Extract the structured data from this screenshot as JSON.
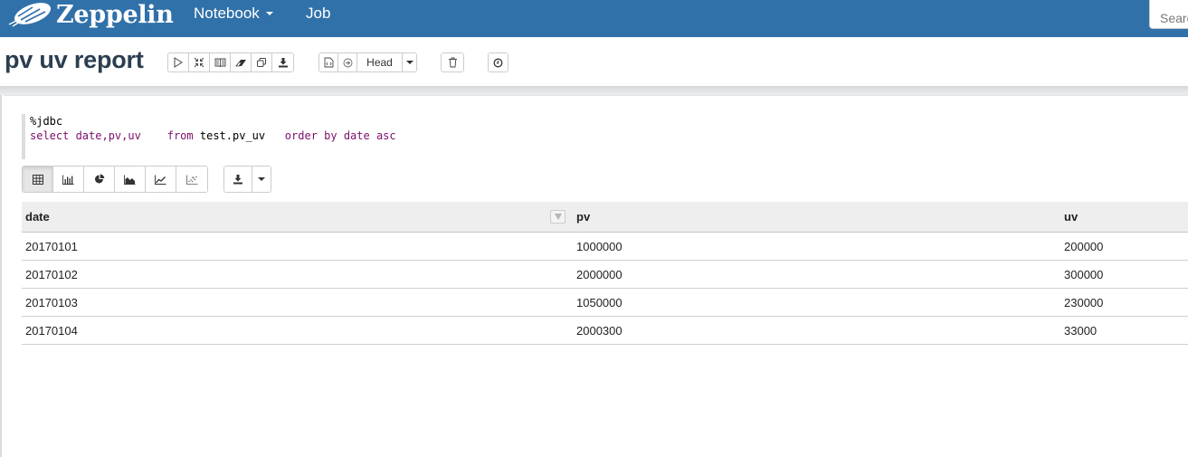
{
  "navbar": {
    "brand": "Zeppelin",
    "items": [
      {
        "label": "Notebook",
        "has_dropdown": true
      },
      {
        "label": "Job",
        "has_dropdown": false
      }
    ],
    "search_placeholder": "Search",
    "bg_color": "#3071a9"
  },
  "header": {
    "title": "pv uv report",
    "toolbar_run": [
      {
        "icon": "play-icon",
        "tooltip": "Run all paragraphs"
      },
      {
        "icon": "collapse-icon",
        "tooltip": "Show/hide the code"
      },
      {
        "icon": "book-icon",
        "tooltip": "Show/hide the output"
      },
      {
        "icon": "eraser-icon",
        "tooltip": "Clear output"
      },
      {
        "icon": "clone-icon",
        "tooltip": "Clone this note"
      },
      {
        "icon": "download-icon",
        "tooltip": "Export this note"
      }
    ],
    "version": {
      "revision_label": "Head"
    },
    "toolbar_delete": {
      "icon": "trash-icon"
    },
    "toolbar_schedule": {
      "icon": "clock-icon"
    }
  },
  "paragraph": {
    "code_lines": [
      "%jdbc",
      "select date,pv,uv    from test.pv_uv   order by date asc"
    ],
    "code_tokens": {
      "line1": "%jdbc",
      "kw_select": "select",
      "cols": " date,pv,uv    ",
      "kw_from": "from",
      "table": " test.pv_uv   ",
      "kw_order": "order by date asc"
    },
    "viz_buttons": [
      {
        "icon": "table-icon",
        "active": true
      },
      {
        "icon": "bar-chart-icon",
        "active": false
      },
      {
        "icon": "pie-chart-icon",
        "active": false
      },
      {
        "icon": "area-chart-icon",
        "active": false
      },
      {
        "icon": "line-chart-icon",
        "active": false
      },
      {
        "icon": "scatter-chart-icon",
        "active": false
      }
    ],
    "download": {
      "icon": "download-icon"
    },
    "table": {
      "columns": [
        "date",
        "pv",
        "uv"
      ],
      "rows": [
        [
          "20170101",
          "1000000",
          "200000"
        ],
        [
          "20170102",
          "2000000",
          "300000"
        ],
        [
          "20170103",
          "1050000",
          "230000"
        ],
        [
          "20170104",
          "2000300",
          "33000"
        ]
      ]
    }
  }
}
